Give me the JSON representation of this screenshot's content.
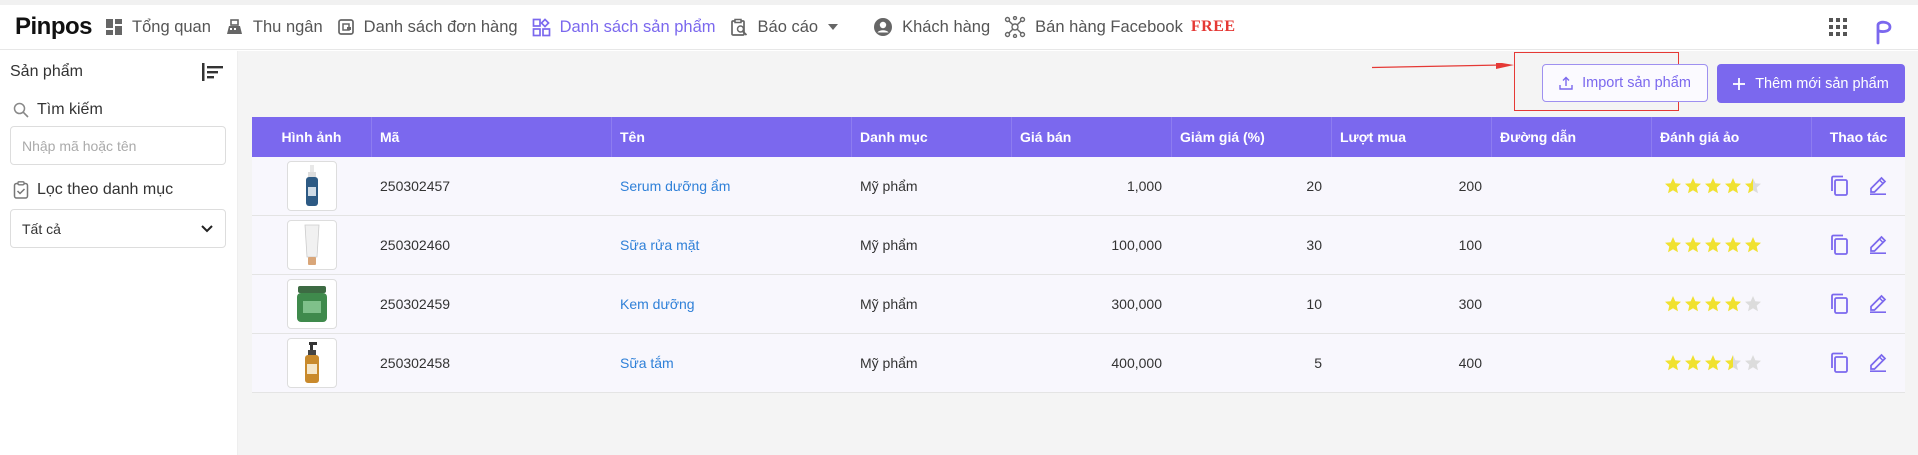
{
  "app": {
    "logo": "Pinpos"
  },
  "nav": [
    {
      "label": "Tổng quan",
      "icon": "dashboard-icon"
    },
    {
      "label": "Thu ngân",
      "icon": "cashier-icon"
    },
    {
      "label": "Danh sách đơn hàng",
      "icon": "orders-icon"
    },
    {
      "label": "Danh sách sản phẩm",
      "icon": "products-icon",
      "active": true
    },
    {
      "label": "Báo cáo",
      "icon": "report-icon",
      "dropdown": true
    },
    {
      "label": "Khách hàng",
      "icon": "customer-icon"
    },
    {
      "label": "Bán hàng Facebook",
      "icon": "network-icon",
      "badge": "FREE"
    }
  ],
  "sidebar": {
    "title": "Sản phẩm",
    "search_label": "Tìm kiếm",
    "search_placeholder": "Nhập mã hoặc tên",
    "filter_label": "Lọc theo danh mục",
    "filter_value": "Tất cả"
  },
  "toolbar": {
    "import_label": "Import sản phẩm",
    "add_label": "Thêm mới sản phẩm"
  },
  "table": {
    "headers": [
      "Hình ảnh",
      "Mã",
      "Tên",
      "Danh mục",
      "Giá bán",
      "Giảm giá (%)",
      "Lượt mua",
      "Đường dẫn",
      "Đánh giá ảo",
      "Thao tác"
    ],
    "rows": [
      {
        "image": "serum-bottle",
        "code": "250302457",
        "name": "Serum dưỡng ẩm",
        "category": "Mỹ phẩm",
        "price": "1,000",
        "discount": "20",
        "purchases": "200",
        "link": "",
        "rating": 4.5
      },
      {
        "image": "cleanser-tube",
        "code": "250302460",
        "name": "Sữa rửa mặt",
        "category": "Mỹ phẩm",
        "price": "100,000",
        "discount": "30",
        "purchases": "100",
        "link": "",
        "rating": 5
      },
      {
        "image": "cream-jar",
        "code": "250302459",
        "name": "Kem dưỡng",
        "category": "Mỹ phẩm",
        "price": "300,000",
        "discount": "10",
        "purchases": "300",
        "link": "",
        "rating": 4
      },
      {
        "image": "body-wash-bottle",
        "code": "250302458",
        "name": "Sữa tắm",
        "category": "Mỹ phẩm",
        "price": "400,000",
        "discount": "5",
        "purchases": "400",
        "link": "",
        "rating": 3.5
      }
    ]
  },
  "colors": {
    "accent": "#7b68ee",
    "link": "#2f80d8",
    "star": "#f0e130",
    "annotation": "#e53935"
  }
}
